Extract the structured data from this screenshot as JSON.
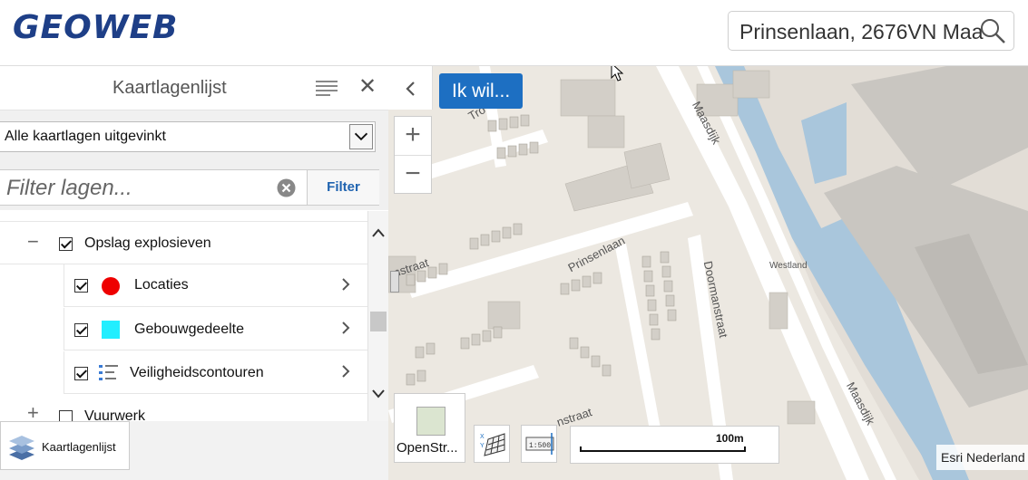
{
  "header": {
    "logo": "GEOWEB",
    "search_value": "Prinsenlaan, 2676VN Maa"
  },
  "panel": {
    "title": "Kaartlagenlijst",
    "select_value": "Alle kaartlagen uitgevinkt",
    "filter_placeholder": "Filter lagen...",
    "filter_button": "Filter",
    "layers": [
      {
        "label": "Opslag explosieven",
        "checked": true,
        "expanded": true
      },
      {
        "label": "Locaties",
        "checked": true,
        "symbol": "red-circle",
        "color": "#ee0000"
      },
      {
        "label": "Gebouwgedeelte",
        "checked": true,
        "symbol": "cyan-square",
        "color": "#22eeff"
      },
      {
        "label": "Veiligheidscontouren",
        "checked": true,
        "symbol": "legend-list-icon"
      },
      {
        "label": "Vuurwerk",
        "checked": false,
        "expanded": false
      }
    ],
    "bottom_tab": "Kaartlagenlijst"
  },
  "map": {
    "ikwil": "Ik wil...",
    "zoom_in": "+",
    "zoom_out": "−",
    "basemap_label": "OpenStr...",
    "scale_label": "100m",
    "attribution": "Esri Nederland",
    "street_labels": [
      "Prinsenlaan",
      "Doormanstraat",
      "Maasdijk",
      "Maasdijk",
      "Westland",
      "Tro",
      "nstraat",
      "nstraat"
    ]
  },
  "colors": {
    "brand": "#1e3f87",
    "accent": "#1d6fc2",
    "water": "#a9c6dc",
    "land": "#ece8e1",
    "building": "#d3cfc8"
  }
}
